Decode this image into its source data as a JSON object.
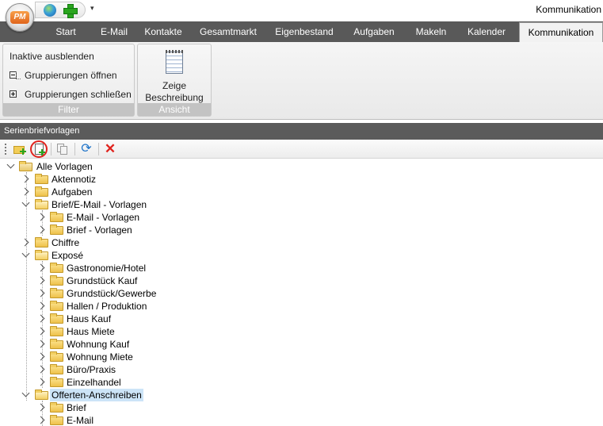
{
  "app": {
    "logo_text": "PM",
    "window_title": "Kommunikation",
    "qat_more": "▾"
  },
  "tabs": [
    {
      "label": "Start"
    },
    {
      "label": "E-Mail"
    },
    {
      "label": "Kontakte"
    },
    {
      "label": "Gesamtmarkt"
    },
    {
      "label": "Eigenbestand"
    },
    {
      "label": "Aufgaben"
    },
    {
      "label": "Makeln"
    },
    {
      "label": "Kalender"
    },
    {
      "label": "Kommunikation",
      "active": true
    }
  ],
  "ribbon": {
    "filter_group": {
      "label": "Filter",
      "hide_inactive": "Inaktive ausblenden",
      "open_groups": "Gruppierungen öffnen",
      "close_groups": "Gruppierungen schließen"
    },
    "view_group": {
      "label": "Ansicht",
      "show_description_line1": "Zeige",
      "show_description_line2": "Beschreibung"
    }
  },
  "panel": {
    "title": "Serienbriefvorlagen"
  },
  "toolbar": {
    "refresh_glyph": "⟳",
    "delete_glyph": "✕"
  },
  "tree": {
    "root": "Alle Vorlagen",
    "items": [
      {
        "label": "Aktennotiz"
      },
      {
        "label": "Aufgaben"
      },
      {
        "label": "Brief/E-Mail - Vorlagen",
        "children": [
          "E-Mail - Vorlagen",
          "Brief - Vorlagen"
        ]
      },
      {
        "label": "Chiffre"
      },
      {
        "label": "Exposé",
        "children": [
          "Gastronomie/Hotel",
          "Grundstück Kauf",
          "Grundstück/Gewerbe",
          "Hallen / Produktion",
          "Haus Kauf",
          "Haus Miete",
          "Wohnung Kauf",
          "Wohnung Miete",
          "Büro/Praxis",
          "Einzelhandel"
        ]
      },
      {
        "label": "Offerten-Anschreiben",
        "selected": true,
        "children": [
          "Brief",
          "E-Mail"
        ]
      }
    ]
  }
}
